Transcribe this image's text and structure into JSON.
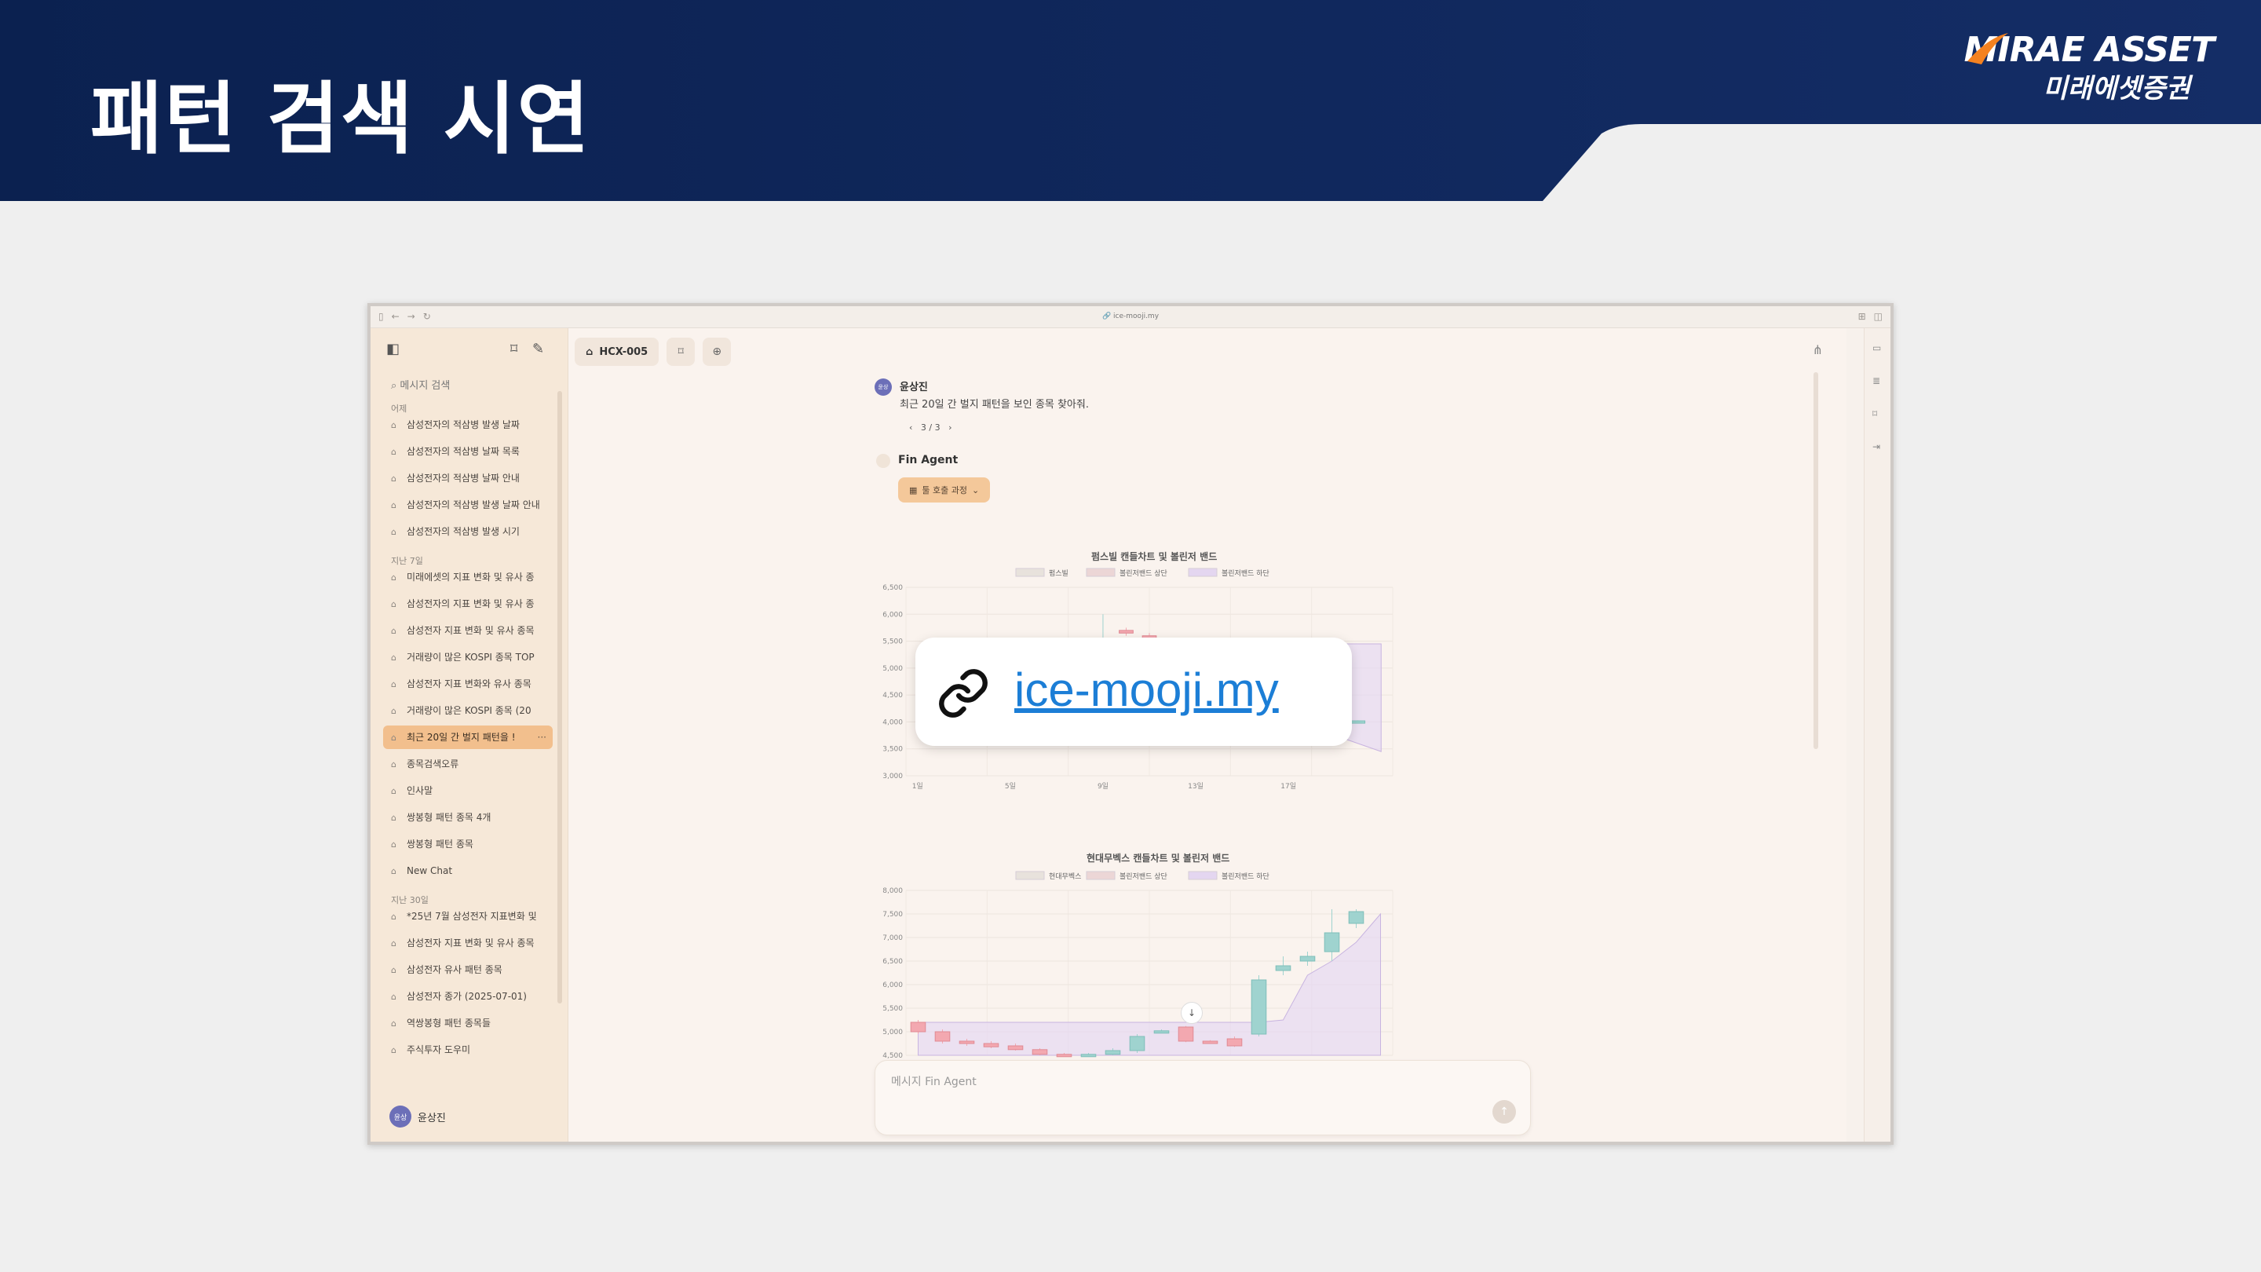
{
  "slide": {
    "title": "패턴 검색 시연",
    "logo_en": "MIRAE ASSET",
    "logo_kr": "미래에셋증권",
    "colors": {
      "banner": "#0d2557",
      "banner_light": "#ffffff",
      "logo_swoosh": "#f58220"
    }
  },
  "browser": {
    "url": "ice-mooji.my"
  },
  "sidebar": {
    "search_placeholder": "메시지 검색",
    "groups": [
      {
        "label": "어제",
        "items": [
          "삼성전자의 적삼병 발생 날짜",
          "삼성전자의 적삼병 날짜 목록",
          "삼성전자의 적삼병 날짜 안내",
          "삼성전자의 적삼병 발생 날짜 안내",
          "삼성전자의 적삼병 발생 시기"
        ]
      },
      {
        "label": "지난 7일",
        "items": [
          "미래에셋의 지표 변화 및 유사 종",
          "삼성전자의 지표 변화 및 유사 종",
          "삼성전자 지표 변화 및 유사 종목",
          "거래량이 많은 KOSPI 종목 TOP",
          "삼성전자 지표 변화와 유사 종목",
          "거래량이 많은 KOSPI 종목 (20",
          "최근 20일 간 벌지 패턴을 !",
          "종목검색오류",
          "인사말",
          "쌍봉형 패턴 종목 4개",
          "쌍봉형 패턴 종목",
          "New Chat"
        ]
      },
      {
        "label": "지난 30일",
        "items": [
          "*25년 7월 삼성전자 지표변화 및",
          "삼성전자 지표 변화 및 유사 종목",
          "삼성전자 유사 패턴 종목",
          "삼성전자 종가 (2025-07-01)",
          "역쌍봉형 패턴 종목들",
          "주식투자 도우미"
        ]
      }
    ],
    "active_item": "최근 20일 간 벌지 패턴을 !",
    "user": {
      "avatar": "윤상",
      "name": "윤상진"
    }
  },
  "tabs": {
    "model": "HCX-005"
  },
  "chat": {
    "user_name": "윤상진",
    "user_message": "최근 20일 간 벌지 패턴을 보인 종목 찾아줘.",
    "pager": "3 / 3",
    "agent_name": "Fin Agent",
    "tool_chip": "툴 호출 과정"
  },
  "link_overlay": {
    "text": "ice-mooji.my"
  },
  "input": {
    "placeholder": "메시지 Fin Agent"
  },
  "chart_data": [
    {
      "type": "candlestick",
      "title": "펌스빌 캔들차트 및 볼린저 밴드",
      "legend": [
        "펌스빌",
        "볼린저밴드 상단",
        "볼린저밴드 하단"
      ],
      "x_ticks": [
        "1일",
        "5일",
        "9일",
        "13일",
        "17일"
      ],
      "y_ticks": [
        3000,
        3500,
        4000,
        4500,
        5000,
        5500,
        6000,
        6500
      ],
      "ylim": [
        3000,
        6500
      ],
      "band_upper": [
        null,
        null,
        null,
        null,
        null,
        null,
        null,
        null,
        null,
        null,
        5450,
        5450,
        5450,
        5450,
        5450,
        5450,
        5450,
        5450,
        5450,
        5450,
        5450
      ],
      "band_lower": [
        null,
        null,
        null,
        null,
        null,
        null,
        null,
        null,
        null,
        null,
        3650,
        3700,
        3750,
        3700,
        3650,
        3600,
        3650,
        3700,
        3750,
        3600,
        3450
      ],
      "candles": [
        {
          "x": 9,
          "open": 5500,
          "close": 5550,
          "high": 6000,
          "low": 5400,
          "up": true
        },
        {
          "x": 10,
          "open": 5700,
          "close": 5650,
          "high": 5750,
          "low": 5600,
          "up": false
        },
        {
          "x": 11,
          "open": 5600,
          "close": 5450,
          "high": 5650,
          "low": 5400,
          "up": false
        },
        {
          "x": 17,
          "open": 4000,
          "close": 4010,
          "high": 4030,
          "low": 3990,
          "up": true
        },
        {
          "x": 18,
          "open": 4010,
          "close": 4000,
          "high": 4020,
          "low": 3990,
          "up": false
        },
        {
          "x": 19,
          "open": 4000,
          "close": 3990,
          "high": 4010,
          "low": 3980,
          "up": false
        },
        {
          "x": 20,
          "open": 3990,
          "close": 4020,
          "high": 4030,
          "low": 3980,
          "up": true
        }
      ]
    },
    {
      "type": "candlestick",
      "title": "현대무벡스 캔들차트 및 볼린저 밴드",
      "legend": [
        "현대무벡스",
        "볼린저밴드 상단",
        "볼린저밴드 하단"
      ],
      "y_ticks": [
        4500,
        5000,
        5500,
        6000,
        6500,
        7000,
        7500,
        8000
      ],
      "ylim": [
        4500,
        8000
      ],
      "band_upper": [
        5200,
        5200,
        5200,
        5200,
        5200,
        5200,
        5200,
        5200,
        5200,
        5200,
        5200,
        5200,
        5200,
        5200,
        5200,
        5250,
        6200,
        6500,
        6900,
        7500
      ],
      "band_lower": [
        4500,
        4500,
        4500,
        4500,
        4500,
        4500,
        4500,
        4500,
        4500,
        4500,
        4500,
        4500,
        4500,
        4500,
        4500,
        4500,
        4500,
        4500,
        4500,
        4500
      ],
      "candles": [
        {
          "x": 1,
          "open": 5200,
          "close": 5000,
          "high": 5250,
          "low": 4950,
          "up": false
        },
        {
          "x": 2,
          "open": 5000,
          "close": 4800,
          "high": 5050,
          "low": 4750,
          "up": false
        },
        {
          "x": 3,
          "open": 4800,
          "close": 4750,
          "high": 4850,
          "low": 4700,
          "up": false
        },
        {
          "x": 4,
          "open": 4750,
          "close": 4680,
          "high": 4800,
          "low": 4650,
          "up": false
        },
        {
          "x": 5,
          "open": 4700,
          "close": 4620,
          "high": 4750,
          "low": 4600,
          "up": false
        },
        {
          "x": 6,
          "open": 4620,
          "close": 4520,
          "high": 4650,
          "low": 4500,
          "up": false
        },
        {
          "x": 7,
          "open": 4520,
          "close": 4500,
          "high": 4550,
          "low": 4480,
          "up": false
        },
        {
          "x": 8,
          "open": 4500,
          "close": 4520,
          "high": 4550,
          "low": 4480,
          "up": true
        },
        {
          "x": 9,
          "open": 4520,
          "close": 4600,
          "high": 4650,
          "low": 4500,
          "up": true
        },
        {
          "x": 10,
          "open": 4600,
          "close": 4900,
          "high": 4950,
          "low": 4550,
          "up": true
        },
        {
          "x": 11,
          "open": 5000,
          "close": 5020,
          "high": 5050,
          "low": 4980,
          "up": true
        },
        {
          "x": 12,
          "open": 5100,
          "close": 4800,
          "high": 5120,
          "low": 4780,
          "up": false
        },
        {
          "x": 13,
          "open": 4800,
          "close": 4780,
          "high": 4820,
          "low": 4760,
          "up": false
        },
        {
          "x": 14,
          "open": 4850,
          "close": 4700,
          "high": 4900,
          "low": 4680,
          "up": false
        },
        {
          "x": 15,
          "open": 4950,
          "close": 6100,
          "high": 6200,
          "low": 4900,
          "up": true
        },
        {
          "x": 16,
          "open": 6300,
          "close": 6400,
          "high": 6600,
          "low": 6200,
          "up": true
        },
        {
          "x": 17,
          "open": 6500,
          "close": 6600,
          "high": 6700,
          "low": 6400,
          "up": true
        },
        {
          "x": 18,
          "open": 6700,
          "close": 7100,
          "high": 7600,
          "low": 6500,
          "up": true
        },
        {
          "x": 19,
          "open": 7300,
          "close": 7550,
          "high": 7600,
          "low": 7200,
          "up": true
        }
      ]
    }
  ]
}
